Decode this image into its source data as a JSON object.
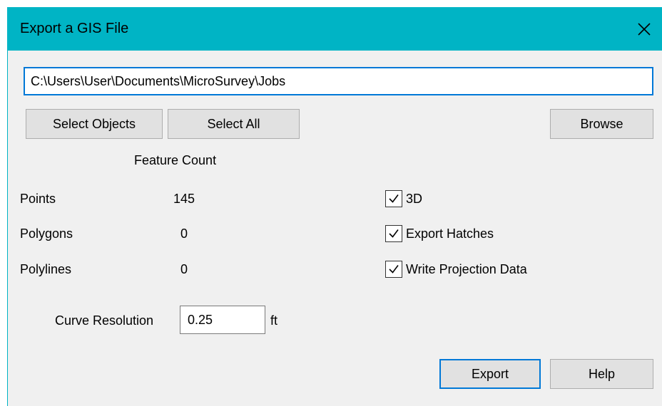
{
  "window": {
    "title": "Export a GIS File"
  },
  "path": {
    "value": "C:\\Users\\User\\Documents\\MicroSurvey\\Jobs"
  },
  "buttons": {
    "select_objects": "Select Objects",
    "select_all": "Select All",
    "browse": "Browse",
    "export": "Export",
    "help": "Help"
  },
  "feature_count": {
    "header": "Feature Count",
    "rows": [
      {
        "label": "Points",
        "value": "145"
      },
      {
        "label": "Polygons",
        "value": "0"
      },
      {
        "label": "Polylines",
        "value": "0"
      }
    ]
  },
  "options": [
    {
      "label": "3D",
      "checked": true
    },
    {
      "label": "Export Hatches",
      "checked": true
    },
    {
      "label": "Write Projection Data",
      "checked": true
    }
  ],
  "curve_resolution": {
    "label": "Curve Resolution",
    "value": "0.25",
    "unit": "ft"
  },
  "icons": {
    "close": "close-icon",
    "check": "check-icon"
  },
  "colors": {
    "titlebar": "#00b4c5",
    "focus": "#0078d7"
  }
}
